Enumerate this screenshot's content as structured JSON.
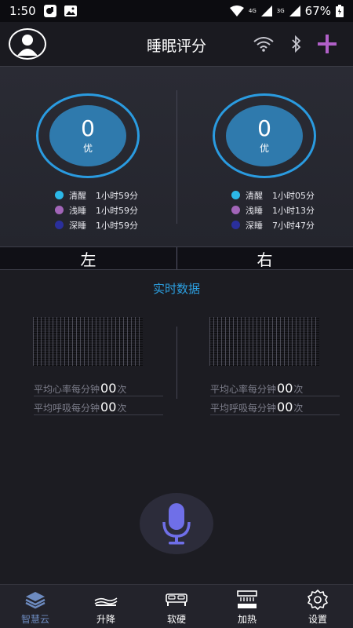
{
  "status_bar": {
    "time": "1:50",
    "network_badge_1": "4G",
    "network_badge_2": "3G",
    "battery": "67%"
  },
  "header": {
    "title": "睡眠评分",
    "icons": [
      "avatar-icon",
      "wifi-icon",
      "bluetooth-icon",
      "add-icon"
    ],
    "accent_color": "#b160c8"
  },
  "sleep": {
    "left": {
      "score": "0",
      "grade": "优",
      "stages": [
        {
          "label": "清醒",
          "time": "1小时59分",
          "color": "#2cb8e8"
        },
        {
          "label": "浅睡",
          "time": "1小时59分",
          "color": "#a265b8"
        },
        {
          "label": "深睡",
          "time": "1小时59分",
          "color": "#2a2f9c"
        }
      ]
    },
    "right": {
      "score": "0",
      "grade": "优",
      "stages": [
        {
          "label": "清醒",
          "time": "1小时05分",
          "color": "#2cb8e8"
        },
        {
          "label": "浅睡",
          "time": "1小时13分",
          "color": "#a265b8"
        },
        {
          "label": "深睡",
          "time": "7小时47分",
          "color": "#2a2f9c"
        }
      ]
    }
  },
  "sides": {
    "left": "左",
    "right": "右"
  },
  "realtime": {
    "title": "实时数据",
    "left": {
      "heart_label": "平均心率每分钟",
      "heart_value": "00",
      "heart_unit": "次",
      "breath_label": "平均呼吸每分钟",
      "breath_value": "00",
      "breath_unit": "次"
    },
    "right": {
      "heart_label": "平均心率每分钟",
      "heart_value": "00",
      "heart_unit": "次",
      "breath_label": "平均呼吸每分钟",
      "breath_value": "00",
      "breath_unit": "次"
    }
  },
  "nav": {
    "items": [
      {
        "label": "智慧云",
        "icon": "layers-icon",
        "active": true
      },
      {
        "label": "升降",
        "icon": "bed-lift-icon",
        "active": false
      },
      {
        "label": "软硬",
        "icon": "bed-firmness-icon",
        "active": false
      },
      {
        "label": "加热",
        "icon": "heating-icon",
        "active": false
      },
      {
        "label": "设置",
        "icon": "gear-icon",
        "active": false
      }
    ]
  },
  "colors": {
    "ring": "#2a9be0",
    "score_fill": "#2f7aad",
    "realtime_title": "#2c9fe0",
    "mic": "#6f6fe8",
    "active_nav": "#6d8bc0"
  }
}
